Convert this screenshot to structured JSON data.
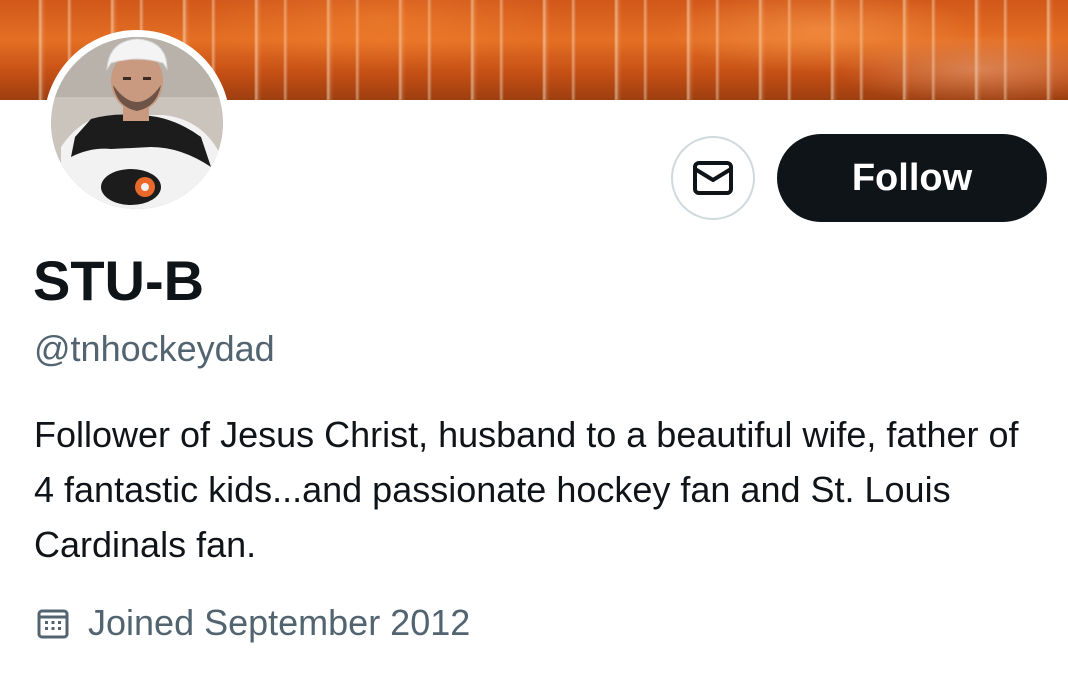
{
  "banner": {
    "icon": "autumn-forest-banner"
  },
  "avatar": {
    "icon": "hockey-player-avatar"
  },
  "actions": {
    "message_icon": "envelope-icon",
    "follow_label": "Follow"
  },
  "profile": {
    "display_name": "STU-B",
    "handle": "@tnhockeydad",
    "bio": "Follower of Jesus Christ, husband to a beautiful wife, father of 4 fantastic kids...and passionate hockey fan and St. Louis Cardinals fan.",
    "joined_icon": "calendar-icon",
    "joined": "Joined September 2012"
  },
  "colors": {
    "text_primary": "#0f1419",
    "text_secondary": "#536471",
    "button_dark": "#0f1419",
    "button_border": "#cfd9de",
    "banner_orange": "#d1581a"
  }
}
